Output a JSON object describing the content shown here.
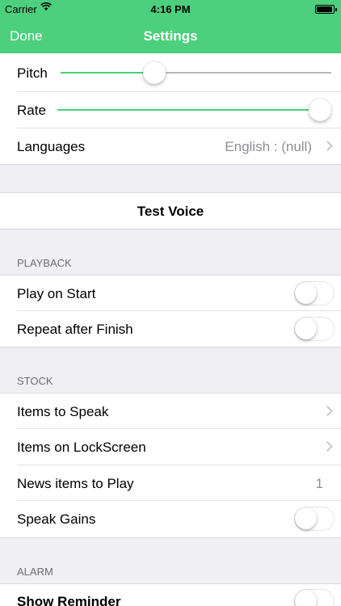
{
  "status_bar": {
    "carrier": "Carrier",
    "time": "4:16 PM"
  },
  "nav": {
    "done_label": "Done",
    "title": "Settings"
  },
  "voice": {
    "pitch_label": "Pitch",
    "pitch_value": 0.34,
    "rate_label": "Rate",
    "rate_value": 1.0,
    "languages_label": "Languages",
    "languages_value": "English : (null)"
  },
  "test_voice_label": "Test Voice",
  "playback": {
    "header": "PLAYBACK",
    "play_on_start_label": "Play on Start",
    "play_on_start_on": false,
    "repeat_label": "Repeat after Finish",
    "repeat_on": false
  },
  "stock": {
    "header": "STOCK",
    "items_to_speak_label": "Items to Speak",
    "items_on_lockscreen_label": "Items on LockScreen",
    "news_items_label": "News items to Play",
    "news_items_value": "1",
    "speak_gains_label": "Speak Gains",
    "speak_gains_on": false
  },
  "alarm": {
    "header": "ALARM",
    "show_reminder_label": "Show Reminder",
    "show_reminder_on": false
  },
  "colors": {
    "accent": "#4cd07d",
    "background": "#efeff4"
  }
}
